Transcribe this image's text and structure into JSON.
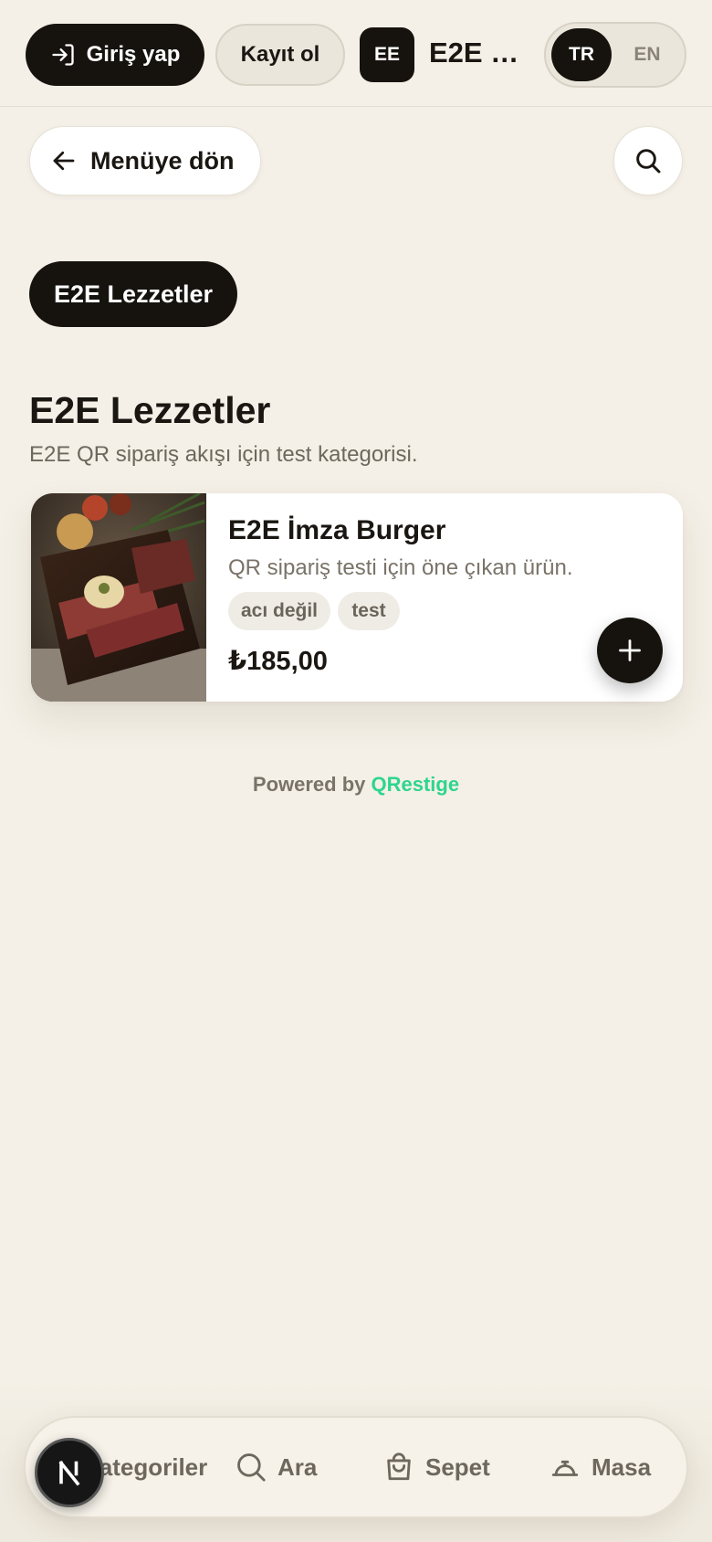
{
  "header": {
    "login_label": "Giriş yap",
    "register_label": "Kayıt ol",
    "avatar_initials": "EE",
    "brand_name": "E2E E...",
    "languages": [
      "TR",
      "EN"
    ],
    "active_language": "TR"
  },
  "nav": {
    "back_label": "Menüye dön"
  },
  "category_chip": "E2E Lezzetler",
  "section": {
    "title": "E2E Lezzetler",
    "description": "E2E QR sipariş akışı için test kategorisi."
  },
  "product": {
    "name": "E2E İmza Burger",
    "description": "QR sipariş testi için öne çıkan ürün.",
    "tags": [
      "acı değil",
      "test"
    ],
    "price": "₺185,00"
  },
  "footer": {
    "powered_prefix": "Powered by",
    "powered_brand": "QRestige",
    "brand_color": "#2ed58e"
  },
  "bottom_nav": {
    "items": [
      {
        "label": "Kategoriler",
        "icon": "categories-icon"
      },
      {
        "label": "Ara",
        "icon": "search-icon"
      },
      {
        "label": "Sepet",
        "icon": "shopping-bag-icon"
      },
      {
        "label": "Masa",
        "icon": "service-bell-icon"
      }
    ]
  },
  "dev_badge": {
    "icon": "nextjs-logo-icon"
  }
}
